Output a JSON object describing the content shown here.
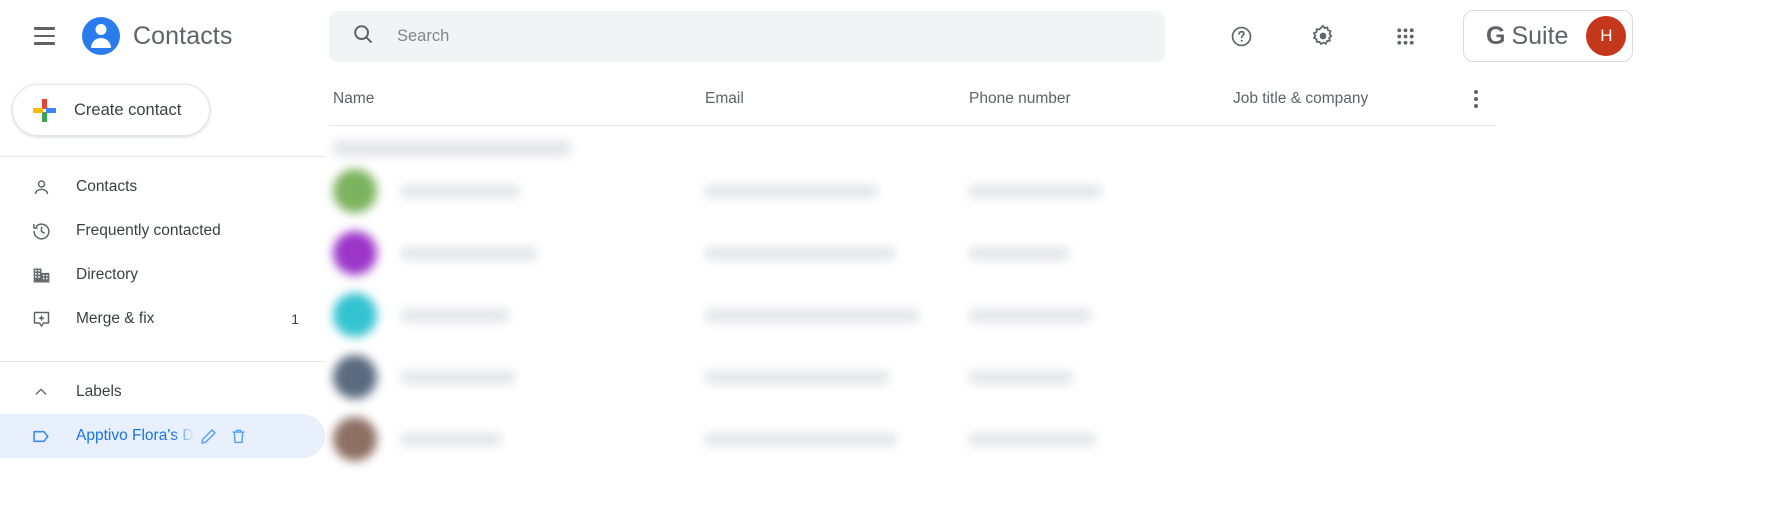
{
  "app": {
    "title": "Contacts",
    "menu_icon": "hamburger-menu-icon",
    "logo_icon": "contacts-person-logo-icon"
  },
  "sidebar": {
    "create_button": {
      "label": "Create contact",
      "icon": "google-plus-icon"
    },
    "nav_items": [
      {
        "label": "Contacts",
        "icon": "person-outline-icon",
        "count": ""
      },
      {
        "label": "Frequently contacted",
        "icon": "history-clock-icon",
        "count": ""
      },
      {
        "label": "Directory",
        "icon": "building-icon",
        "count": ""
      },
      {
        "label": "Merge & fix",
        "icon": "merge-fix-icon",
        "count": "1"
      }
    ],
    "labels_section": {
      "title": "Labels",
      "collapse_icon": "chevron-up-icon",
      "items": [
        {
          "label": "Apptivo Flora's D",
          "tag_icon": "label-tag-icon",
          "edit_icon": "pencil-edit-icon",
          "delete_icon": "trash-delete-icon",
          "selected": true
        }
      ]
    }
  },
  "topbar": {
    "search": {
      "placeholder": "Search",
      "value": "",
      "icon": "search-icon"
    },
    "help_icon": "help-question-circle-icon",
    "settings_icon": "gear-settings-icon",
    "apps_icon": "apps-grid-icon",
    "gsuite_badge": {
      "g": "G",
      "word": "Suite"
    },
    "account_avatar": {
      "initial": "H",
      "color": "#c5371a"
    }
  },
  "table": {
    "columns": [
      {
        "label": "Name"
      },
      {
        "label": "Email"
      },
      {
        "label": "Phone number"
      },
      {
        "label": "Job title & company"
      }
    ],
    "more_icon": "more-vertical-icon",
    "group_header_redacted": true,
    "rows": [
      {
        "avatar_color": "#7cb35e",
        "redacted": true
      },
      {
        "avatar_color": "#9c36c9",
        "redacted": true
      },
      {
        "avatar_color": "#34c3d1",
        "redacted": true
      },
      {
        "avatar_color": "#5a6b80",
        "redacted": true
      },
      {
        "avatar_color": "#8d6f63",
        "redacted": true
      }
    ],
    "row_widths": [
      {
        "name": 118,
        "email": 172,
        "phone": 132
      },
      {
        "name": 136,
        "email": 190,
        "phone": 100
      },
      {
        "name": 108,
        "email": 214,
        "phone": 122
      },
      {
        "name": 114,
        "email": 184,
        "phone": 104
      },
      {
        "name": 100,
        "email": 192,
        "phone": 126
      }
    ]
  },
  "colors": {
    "accent_blue": "#1a73e8",
    "selected_bg": "#e8f0fe",
    "search_bg": "#f1f3f4",
    "text_primary": "#3c4043",
    "text_secondary": "#5f6368"
  }
}
